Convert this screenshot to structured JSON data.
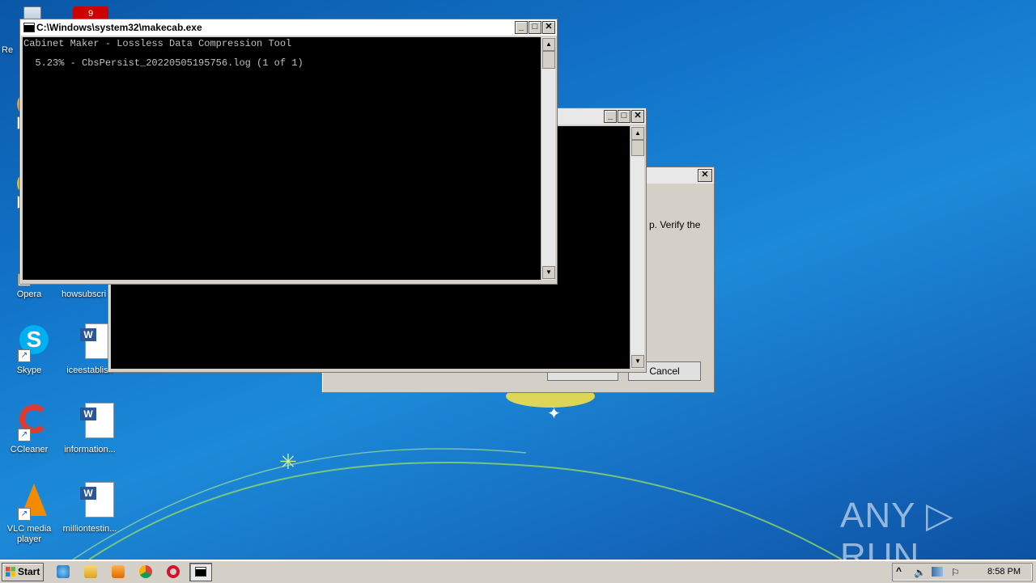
{
  "desktop": {
    "icons": [
      {
        "label": "Re"
      },
      {
        "label": "F"
      },
      {
        "label": "C"
      },
      {
        "label": "Opera"
      },
      {
        "label": "howsubscri"
      },
      {
        "label": "Skype"
      },
      {
        "label": "iceestablish"
      },
      {
        "label": "CCleaner"
      },
      {
        "label": "information..."
      },
      {
        "label": "VLC media player"
      },
      {
        "label": "milliontestin..."
      }
    ],
    "recycle_badge": "9"
  },
  "windows": {
    "makecab": {
      "title": "C:\\Windows\\system32\\makecab.exe",
      "lines": [
        "Cabinet Maker - Lossless Data Compression Tool",
        "  5.23% - CbsPersist_20220505195756.log (1 of 1)"
      ],
      "min": "_",
      "max": "□",
      "close": "✕"
    },
    "console2": {
      "min": "_",
      "max": "□",
      "close": "✕"
    },
    "dialog": {
      "close": "✕",
      "message_fragment": "p. Verify the",
      "cancel_label": "Cancel"
    }
  },
  "taskbar": {
    "start_label": "Start",
    "clock": "8:58 PM",
    "tray_chevron": "^"
  },
  "watermark": "ANY ▷ RUN",
  "colors": {
    "console_bg": "#000000",
    "desktop": "#1377cc",
    "taskbar": "#d4d0c8"
  }
}
